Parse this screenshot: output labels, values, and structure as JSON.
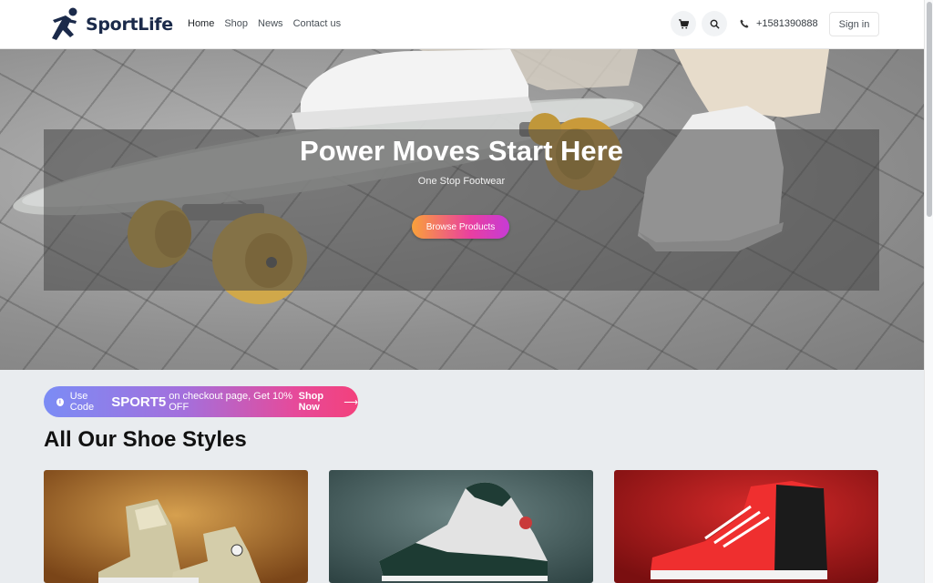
{
  "brand": {
    "name": "SportLife"
  },
  "nav": {
    "items": [
      "Home",
      "Shop",
      "News",
      "Contact us"
    ]
  },
  "header": {
    "phone": "+1581390888",
    "signin_label": "Sign in",
    "cart_icon": "cart-icon",
    "search_icon": "search-icon"
  },
  "hero": {
    "title": "Power Moves Start Here",
    "subtitle": "One Stop Footwear",
    "cta_label": "Browse Products"
  },
  "promo": {
    "prefix": "Use Code",
    "code": "SPORT5",
    "middle": "on checkout page, Get 10% OFF",
    "shop_label": "Shop Now",
    "arrow": "⟶"
  },
  "section": {
    "title": "All Our Shoe Styles"
  },
  "colors": {
    "accent_start": "#f9a13a",
    "accent_end": "#c63bd6",
    "promo_start": "#7b8cf5",
    "promo_end": "#f3417c",
    "brand_text": "#1b2a4a"
  }
}
